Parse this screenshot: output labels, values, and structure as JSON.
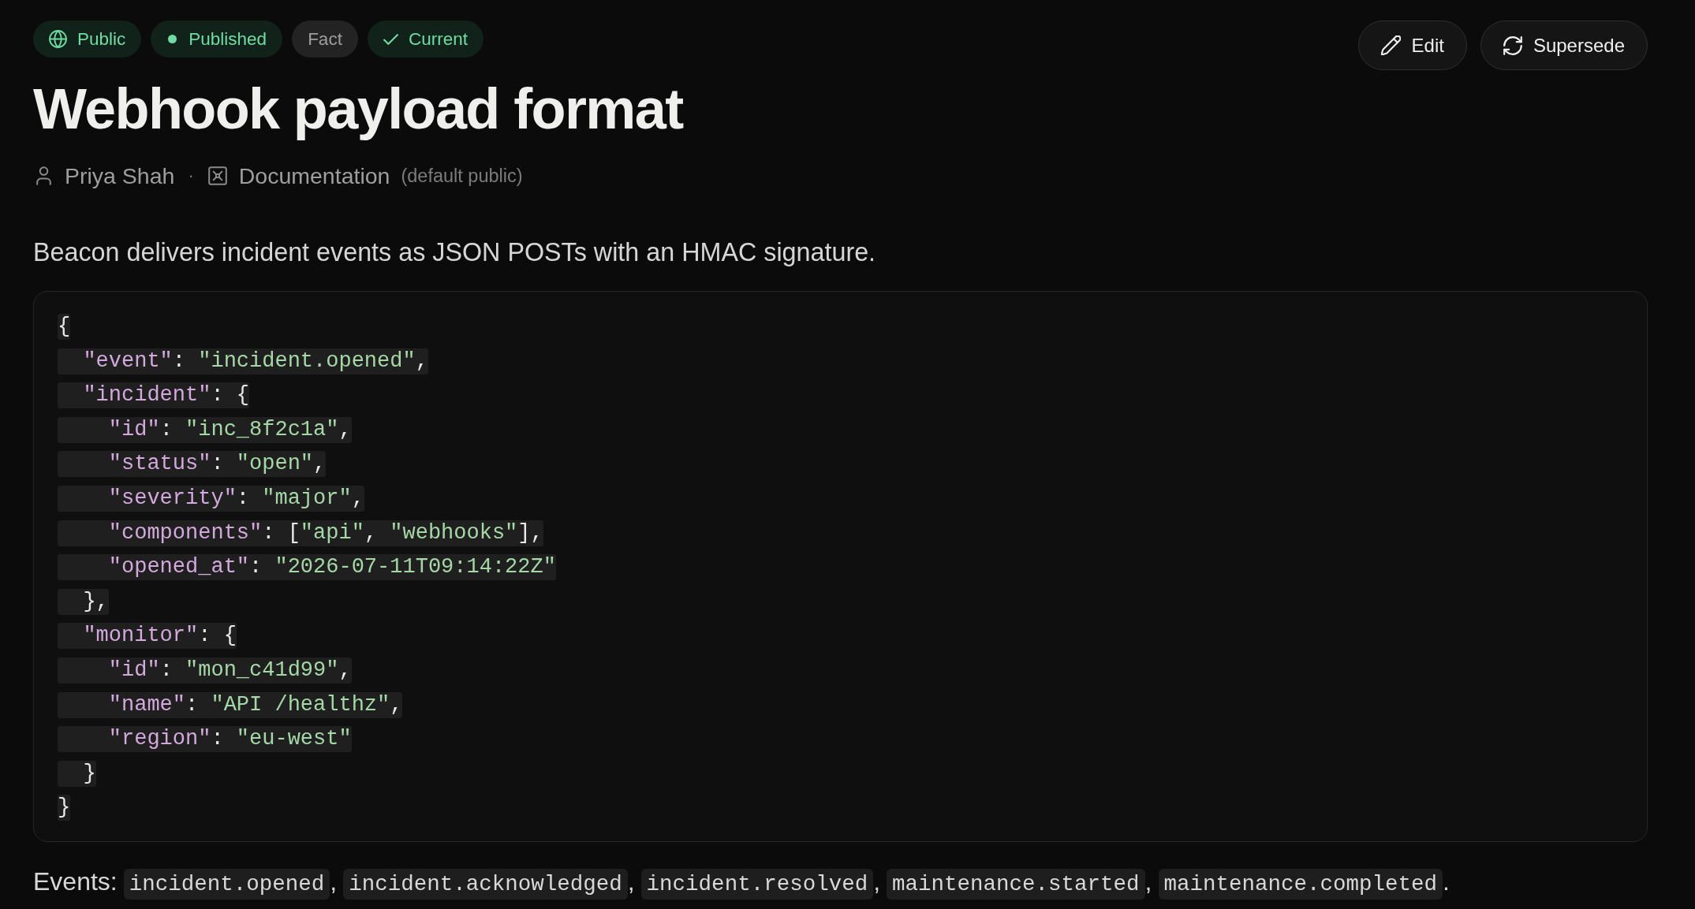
{
  "badges": [
    {
      "label": "Public",
      "kind": "visibility"
    },
    {
      "label": "Published",
      "kind": "status"
    },
    {
      "label": "Fact",
      "kind": "category"
    },
    {
      "label": "Current",
      "kind": "validity"
    }
  ],
  "actions": [
    {
      "label": "Edit",
      "kind": "edit"
    },
    {
      "label": "Supersede",
      "kind": "supersede"
    }
  ],
  "title": "Webhook payload format",
  "meta": {
    "author": "Priya Shah",
    "separator": "·",
    "collection": "Documentation",
    "collection_note": "(default public)"
  },
  "description": "Beacon delivers incident events as JSON POSTs with an HMAC signature.",
  "code_block": {
    "lines": [
      [
        {
          "kind": "punct",
          "text": "{"
        }
      ],
      [
        {
          "kind": "key",
          "text": "  \"event\""
        },
        {
          "kind": "punct",
          "text": ": "
        },
        {
          "kind": "string",
          "text": "\"incident.opened\""
        },
        {
          "kind": "punct",
          "text": ","
        }
      ],
      [
        {
          "kind": "key",
          "text": "  \"incident\""
        },
        {
          "kind": "punct",
          "text": ": {"
        }
      ],
      [
        {
          "kind": "key",
          "text": "    \"id\""
        },
        {
          "kind": "punct",
          "text": ": "
        },
        {
          "kind": "string",
          "text": "\"inc_8f2c1a\""
        },
        {
          "kind": "punct",
          "text": ","
        }
      ],
      [
        {
          "kind": "key",
          "text": "    \"status\""
        },
        {
          "kind": "punct",
          "text": ": "
        },
        {
          "kind": "string",
          "text": "\"open\""
        },
        {
          "kind": "punct",
          "text": ","
        }
      ],
      [
        {
          "kind": "key",
          "text": "    \"severity\""
        },
        {
          "kind": "punct",
          "text": ": "
        },
        {
          "kind": "string",
          "text": "\"major\""
        },
        {
          "kind": "punct",
          "text": ","
        }
      ],
      [
        {
          "kind": "key",
          "text": "    \"components\""
        },
        {
          "kind": "punct",
          "text": ": ["
        },
        {
          "kind": "string",
          "text": "\"api\""
        },
        {
          "kind": "punct",
          "text": ", "
        },
        {
          "kind": "string",
          "text": "\"webhooks\""
        },
        {
          "kind": "punct",
          "text": "],"
        }
      ],
      [
        {
          "kind": "key",
          "text": "    \"opened_at\""
        },
        {
          "kind": "punct",
          "text": ": "
        },
        {
          "kind": "string",
          "text": "\"2026-07-11T09:14:22Z\""
        }
      ],
      [
        {
          "kind": "punct",
          "text": "  },"
        }
      ],
      [
        {
          "kind": "key",
          "text": "  \"monitor\""
        },
        {
          "kind": "punct",
          "text": ": {"
        }
      ],
      [
        {
          "kind": "key",
          "text": "    \"id\""
        },
        {
          "kind": "punct",
          "text": ": "
        },
        {
          "kind": "string",
          "text": "\"mon_c41d99\""
        },
        {
          "kind": "punct",
          "text": ","
        }
      ],
      [
        {
          "kind": "key",
          "text": "    \"name\""
        },
        {
          "kind": "punct",
          "text": ": "
        },
        {
          "kind": "string",
          "text": "\"API /healthz\""
        },
        {
          "kind": "punct",
          "text": ","
        }
      ],
      [
        {
          "kind": "key",
          "text": "    \"region\""
        },
        {
          "kind": "punct",
          "text": ": "
        },
        {
          "kind": "string",
          "text": "\"eu-west\""
        }
      ],
      [
        {
          "kind": "punct",
          "text": "  }"
        }
      ],
      [
        {
          "kind": "punct",
          "text": "}"
        }
      ]
    ]
  },
  "events": {
    "label": "Events:",
    "items": [
      {
        "code": "incident.opened",
        "after": ","
      },
      {
        "code": "incident.acknowledged",
        "after": ","
      },
      {
        "code": "incident.resolved",
        "after": ","
      },
      {
        "code": "maintenance.started",
        "after": ","
      },
      {
        "code": "maintenance.completed",
        "after": "."
      }
    ]
  }
}
